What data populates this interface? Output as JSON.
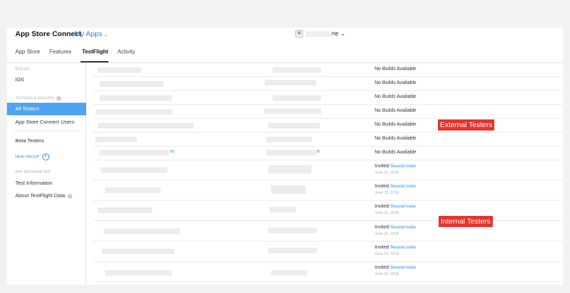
{
  "topbar": {
    "brand": "App Store Connect",
    "my_apps": "My Apps",
    "app_name_suffix": "ne"
  },
  "tabs": [
    {
      "label": "App Store"
    },
    {
      "label": "Features"
    },
    {
      "label": "TestFlight",
      "active": true
    },
    {
      "label": "Activity"
    }
  ],
  "sidebar": {
    "builds_header": "BUILDS",
    "ios": "iOS",
    "testers_header": "TESTERS & GROUPS",
    "all_testers": "All Testers",
    "asc_users": "App Store Connect Users",
    "beta_testers": "Beta Testers",
    "new_group": "NEW GROUP",
    "app_info_header": "APP INFORMATION",
    "test_information": "Test Information",
    "about_data": "About TestFlight Data"
  },
  "rows": [
    {
      "status": "No Builds Available"
    },
    {
      "status": "No Builds Available"
    },
    {
      "status": "No Builds Available"
    },
    {
      "status": "No Builds Available"
    },
    {
      "status": "No Builds Available"
    },
    {
      "status": "No Builds Available"
    },
    {
      "status": "No Builds Available",
      "email_tail": "m",
      "col2_tail": "e"
    },
    {
      "status": "Invited",
      "resend": "Resend Invite",
      "date": "June 22, 2018"
    },
    {
      "status": "Invited",
      "resend": "Resend Invite",
      "date": "June 22, 2018"
    },
    {
      "status": "Invited",
      "resend": "Resend Invite",
      "date": "June 22, 2018"
    },
    {
      "status": "Invited",
      "resend": "Resend Invite",
      "date": "June 22, 2018"
    },
    {
      "status": "Invited",
      "resend": "Resend Invite",
      "date": "June 22, 2018"
    },
    {
      "status": "Invited",
      "resend": "Resend Invite",
      "date": "June 22, 2018"
    }
  ],
  "annotations": {
    "external": "External Testers",
    "internal": "Internal Testers"
  }
}
